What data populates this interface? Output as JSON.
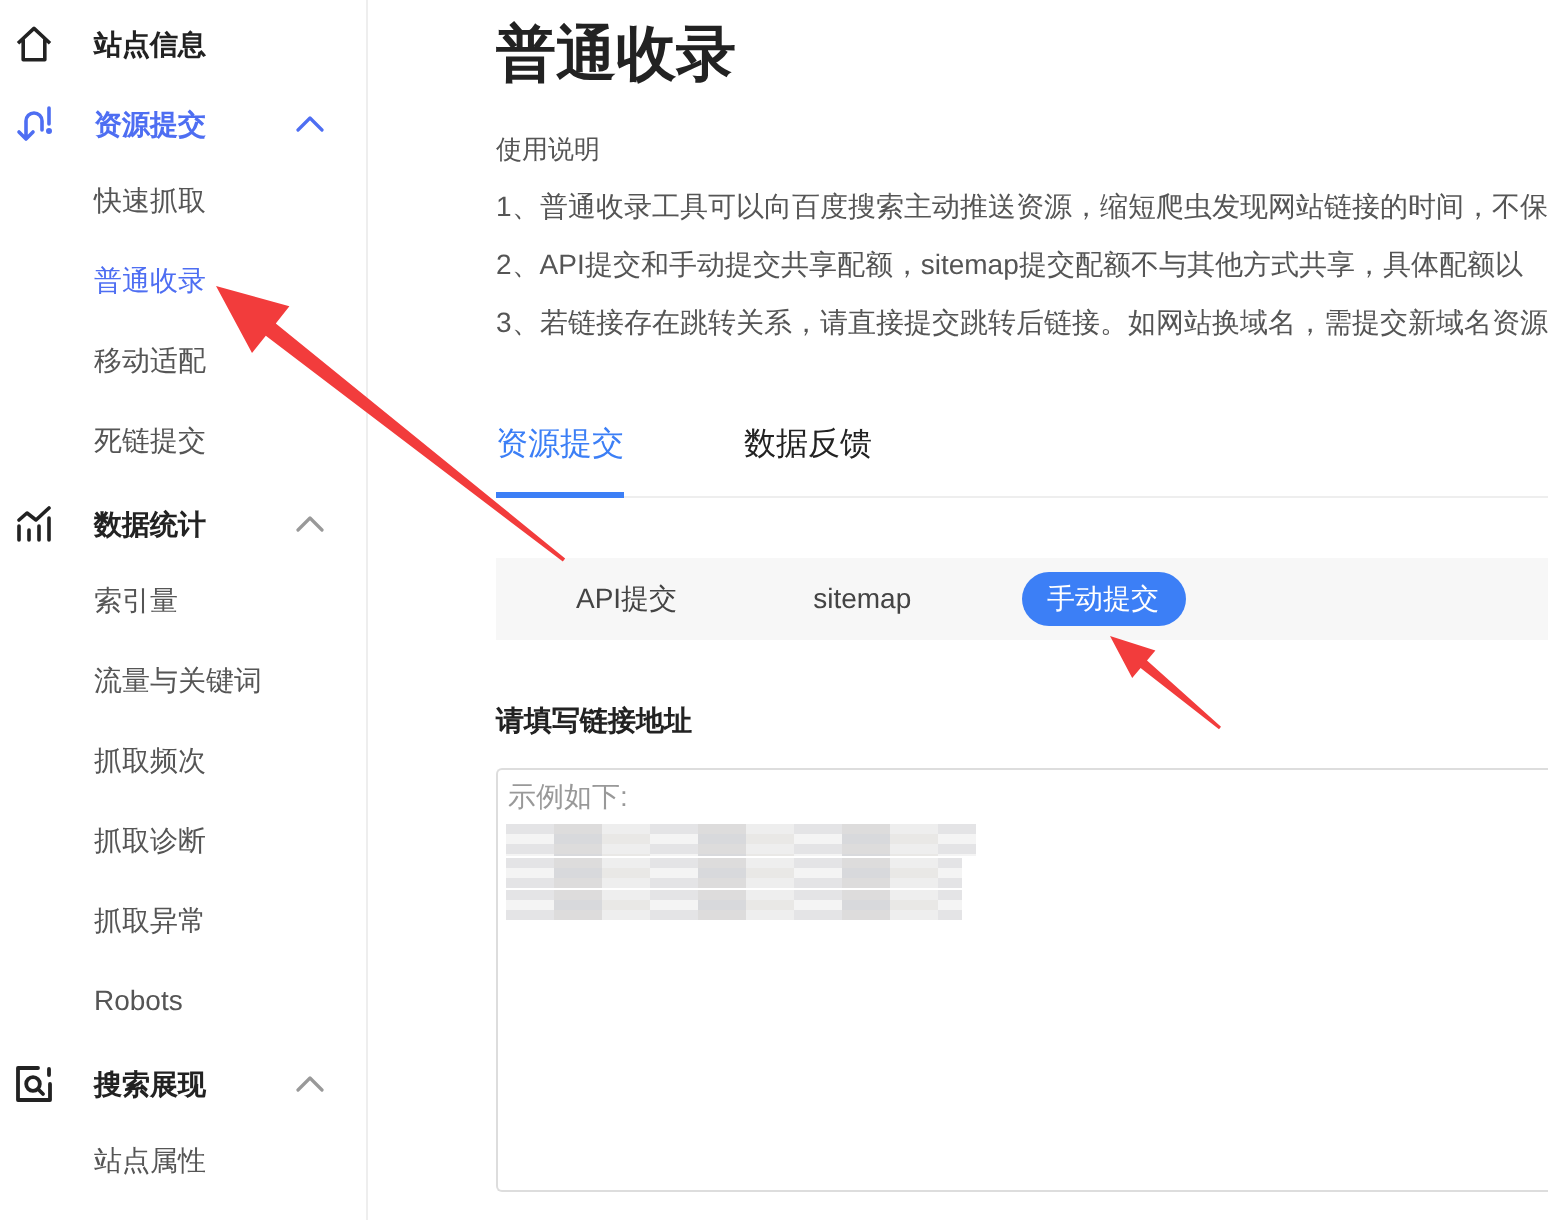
{
  "sidebar": {
    "sections": [
      {
        "kind": "link",
        "label": "站点信息",
        "active": false
      },
      {
        "kind": "group",
        "label": "资源提交",
        "active": true,
        "expanded": true,
        "items": [
          {
            "label": "快速抓取",
            "selected": false
          },
          {
            "label": "普通收录",
            "selected": true
          },
          {
            "label": "移动适配",
            "selected": false
          },
          {
            "label": "死链提交",
            "selected": false
          }
        ]
      },
      {
        "kind": "group",
        "label": "数据统计",
        "active": false,
        "expanded": true,
        "items": [
          {
            "label": "索引量",
            "selected": false
          },
          {
            "label": "流量与关键词",
            "selected": false
          },
          {
            "label": "抓取频次",
            "selected": false
          },
          {
            "label": "抓取诊断",
            "selected": false
          },
          {
            "label": "抓取异常",
            "selected": false
          },
          {
            "label": "Robots",
            "selected": false
          }
        ]
      },
      {
        "kind": "group",
        "label": "搜索展现",
        "active": false,
        "expanded": true,
        "items": [
          {
            "label": "站点属性",
            "selected": false
          }
        ]
      }
    ]
  },
  "title": "普通收录",
  "instructions": {
    "heading": "使用说明",
    "lines": [
      "1、普通收录工具可以向百度搜索主动推送资源，缩短爬虫发现网站链接的时间，不保",
      "2、API提交和手动提交共享配额，sitemap提交配额不与其他方式共享，具体配额以",
      "3、若链接存在跳转关系，请直接提交跳转后链接。如网站换域名，需提交新域名资源"
    ]
  },
  "tabs": [
    {
      "label": "资源提交",
      "selected": true
    },
    {
      "label": "数据反馈",
      "selected": false
    }
  ],
  "methods": [
    {
      "label": "API提交",
      "selected": false
    },
    {
      "label": "sitemap",
      "selected": false
    },
    {
      "label": "手动提交",
      "selected": true
    }
  ],
  "url_input": {
    "label": "请填写链接地址",
    "placeholder": "示例如下:"
  }
}
